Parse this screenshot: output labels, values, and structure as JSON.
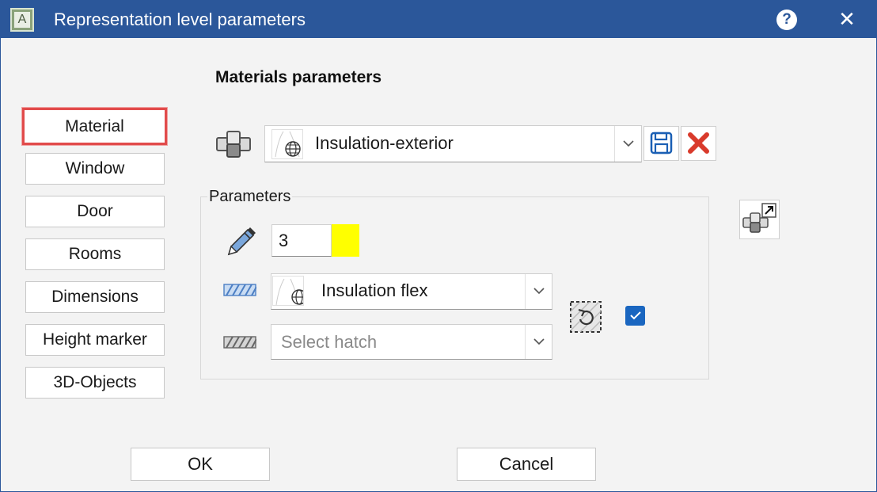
{
  "window": {
    "title": "Representation level parameters",
    "app_icon_letter": "A",
    "help_label": "?",
    "close_label": "✕"
  },
  "heading": "Materials parameters",
  "nav": [
    {
      "label": "Material",
      "active": true
    },
    {
      "label": "Window"
    },
    {
      "label": "Door"
    },
    {
      "label": "Rooms"
    },
    {
      "label": "Dimensions"
    },
    {
      "label": "Height marker"
    },
    {
      "label": "3D-Objects"
    }
  ],
  "material": {
    "selected": "Insulation-exterior"
  },
  "parameters": {
    "group_label": "Parameters",
    "pen_value": "3",
    "pen_color": "#ffff00",
    "hatch1": "Insulation flex",
    "hatch2_placeholder": "Select hatch",
    "checkbox_checked": true
  },
  "buttons": {
    "ok": "OK",
    "cancel": "Cancel"
  },
  "colors": {
    "titlebar": "#2b579a",
    "active_outline": "#e14b4b",
    "checkbox": "#1a66c0"
  }
}
